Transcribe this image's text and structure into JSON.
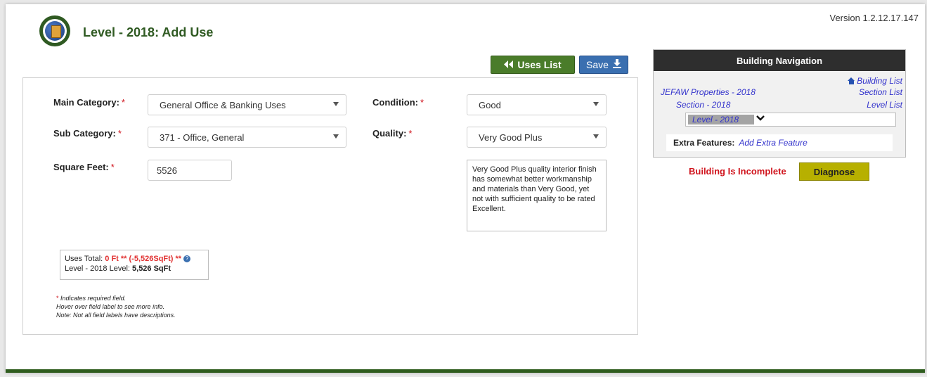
{
  "header": {
    "version": "Version 1.2.12.17.147",
    "title": "Level - 2018: Add Use"
  },
  "toolbar": {
    "uses_list_label": "Uses List",
    "save_label": "Save",
    "uses_list_icon": "double-chevron-left-icon",
    "save_icon": "download-icon"
  },
  "form": {
    "main_category": {
      "label": "Main Category:",
      "required_mark": "*",
      "value": "General Office & Banking Uses"
    },
    "sub_category": {
      "label": "Sub Category:",
      "required_mark": "*",
      "value": "371 - Office, General"
    },
    "square_feet": {
      "label": "Square Feet:",
      "required_mark": "*",
      "value": "5526"
    },
    "condition": {
      "label": "Condition:",
      "required_mark": "*",
      "value": "Good"
    },
    "quality": {
      "label": "Quality:",
      "required_mark": "*",
      "value": "Very Good Plus"
    },
    "quality_description": "Very Good Plus quality interior finish has somewhat better workmanship and materials than Very Good, yet not with sufficient quality to be rated Excellent."
  },
  "totals": {
    "uses_label": "Uses Total:",
    "uses_value": "0 Ft ** (-5,526SqFt) **",
    "level_label": "Level - 2018 Level:",
    "level_value": "5,526 SqFt"
  },
  "notes": {
    "required_star": "*",
    "required_text": "Indicates required field.",
    "hover_text": "Hover over field label to see more info.",
    "note_text": "Note: Not all field labels have descriptions."
  },
  "building_nav": {
    "header": "Building Navigation",
    "building_list": "Building List",
    "properties": "JEFAW Properties - 2018",
    "section_list": "Section List",
    "section": "Section - 2018",
    "level_list": "Level List",
    "level": "Level - 2018",
    "extra_features_label": "Extra Features:",
    "add_extra_feature": "Add Extra Feature"
  },
  "status": {
    "incomplete": "Building Is Incomplete",
    "diagnose_label": "Diagnose"
  },
  "colors": {
    "brand_green": "#2f5a22",
    "save_blue": "#3a6fb0",
    "error_red": "#d0141d",
    "link_blue": "#3333cc",
    "diagnose_yellow": "#b7b000"
  }
}
